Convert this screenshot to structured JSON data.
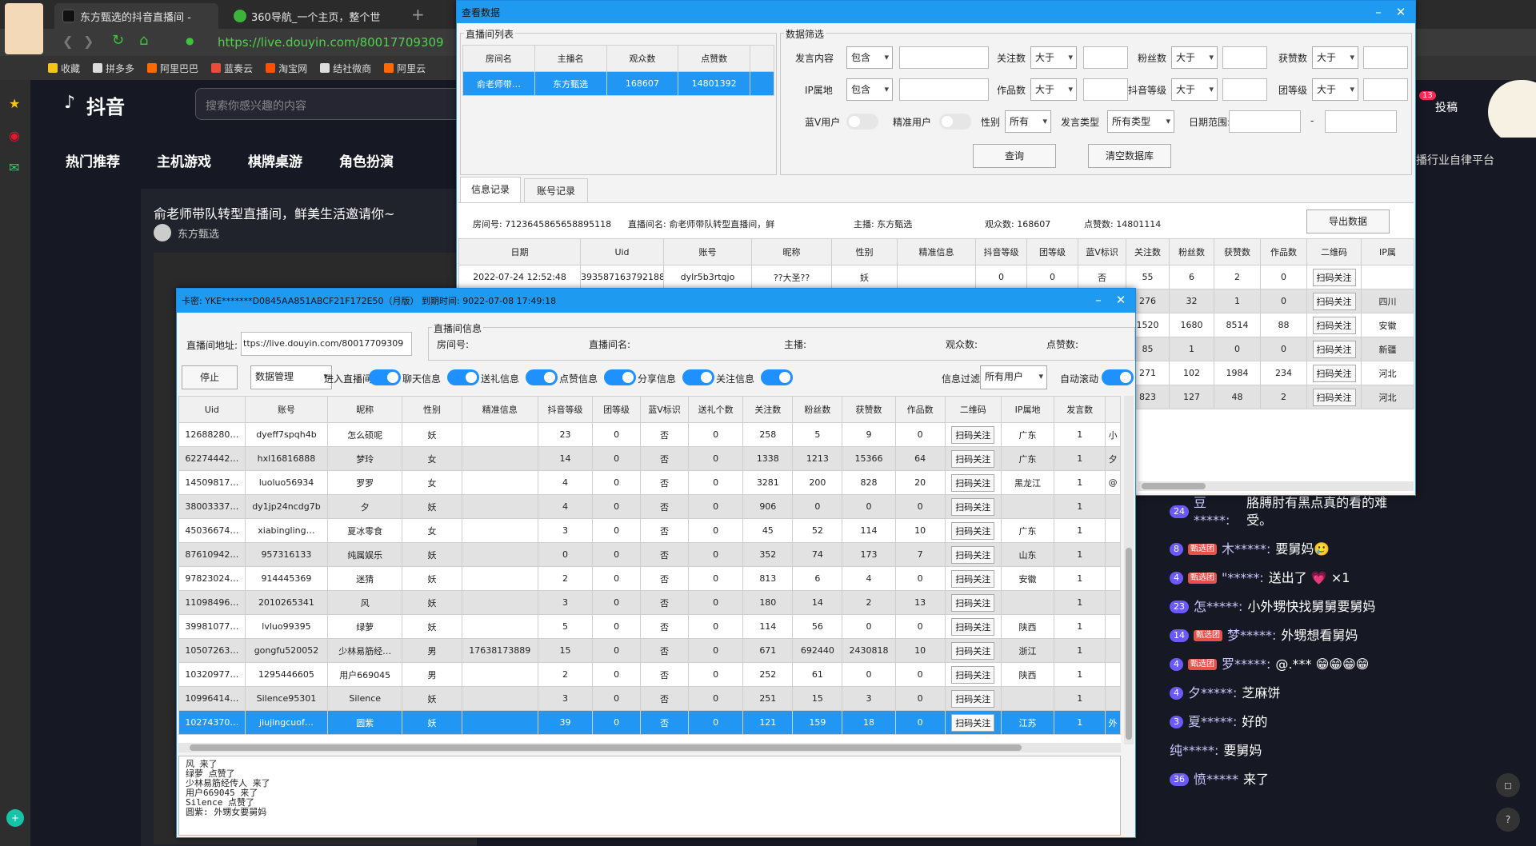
{
  "browser": {
    "tabs": [
      {
        "label": "东方甄选的抖音直播间 -"
      },
      {
        "label": "360导航_一个主页，整个世"
      }
    ],
    "url": "https://live.douyin.com/80017709309",
    "bookmarks": [
      "收藏",
      "拼多多",
      "阿里巴巴",
      "蓝奏云",
      "淘宝网",
      "结社微商",
      "阿里云"
    ]
  },
  "douyin": {
    "logo": "抖音",
    "search_placeholder": "搜索你感兴趣的内容",
    "nav": [
      "热门推荐",
      "主机游戏",
      "棋牌桌游",
      "角色扮演"
    ],
    "live_title": "俞老师带队转型直播间，鲜美生活邀请你~",
    "anchor": "东方甄选",
    "header_right": "投稿",
    "badge": "13",
    "industry_text": "播行业自律平台",
    "chat": [
      {
        "level": "24",
        "user": "豆*****:",
        "text": "胳膊肘有黑点真的看的难受。"
      },
      {
        "level": "8",
        "fan": "甄选团",
        "user": "木*****:",
        "text": "要舅妈🥲"
      },
      {
        "level": "4",
        "fan": "甄选团",
        "user": "\"*****:",
        "text": "送出了 💗 ×1"
      },
      {
        "level": "23",
        "user": "怎*****:",
        "text": "小外甥快找舅舅要舅妈"
      },
      {
        "level": "14",
        "fan": "甄选团",
        "user": "梦*****:",
        "text": "外甥想看舅妈"
      },
      {
        "level": "4",
        "fan": "甄选团",
        "user": "罗*****:",
        "text": "@.*** 😁😁😁😁"
      },
      {
        "level": "4",
        "user": "夕*****:",
        "text": "芝麻饼"
      },
      {
        "level": "3",
        "user": "夏*****:",
        "text": "好的"
      },
      {
        "level": "",
        "user": "纯*****:",
        "text": "要舅妈"
      },
      {
        "level": "36",
        "user": "愤*****",
        "text": "来了"
      }
    ]
  },
  "viewer": {
    "title": "查看数据",
    "live_list_group": "直播间列表",
    "live_list_headers": [
      "房间名",
      "主播名",
      "观众数",
      "点赞数"
    ],
    "live_list_row": [
      "俞老师带…",
      "东方甄选",
      "168607",
      "14801392"
    ],
    "filter_group": "数据筛选",
    "filters": {
      "speech_content": "发言内容",
      "contains1": "包含",
      "follow": "关注数",
      "gt1": "大于",
      "fans": "粉丝数",
      "gt2": "大于",
      "likes": "获赞数",
      "gt3": "大于",
      "ip": "IP属地",
      "contains2": "包含",
      "works": "作品数",
      "gt4": "大于",
      "dylevel": "抖音等级",
      "gt5": "大于",
      "grouplevel": "团等级",
      "gt6": "大于",
      "bluev": "蓝V用户",
      "precise": "精准用户",
      "gender": "性别",
      "all": "所有",
      "speech_type": "发言类型",
      "all_types": "所有类型",
      "date_range": "日期范围:",
      "dash": "-"
    },
    "query_btn": "查询",
    "clear_btn": "清空数据库",
    "tabs": [
      "信息记录",
      "账号记录"
    ],
    "info": {
      "room_id": "房间号: 7123645865658895118",
      "room_name": "直播间名: 俞老师带队转型直播间，鲜",
      "anchor": "主播: 东方甄选",
      "viewers": "观众数: 168607",
      "likes": "点赞数: 14801114"
    },
    "export_btn": "导出数据",
    "record_headers": [
      "日期",
      "Uid",
      "账号",
      "昵称",
      "性别",
      "精准信息",
      "抖音等级",
      "团等级",
      "蓝V标识",
      "关注数",
      "粉丝数",
      "获赞数",
      "作品数",
      "二维码",
      "IP属"
    ],
    "record_rows": [
      [
        "2022-07-24 12:52:48",
        "3935871637921880",
        "dylr5b3rtqjo",
        "??大圣??",
        "妖",
        "",
        "0",
        "0",
        "否",
        "55",
        "6",
        "2",
        "0",
        "扫码关注",
        ""
      ],
      [
        "",
        "",
        "",
        "",
        "",
        "",
        "",
        "",
        "",
        "276",
        "32",
        "1",
        "0",
        "扫码关注",
        "四川"
      ],
      [
        "",
        "",
        "",
        "",
        "",
        "",
        "",
        "",
        "",
        "1520",
        "1680",
        "8514",
        "88",
        "扫码关注",
        "安徽"
      ],
      [
        "",
        "",
        "",
        "",
        "",
        "",
        "",
        "",
        "",
        "85",
        "1",
        "0",
        "0",
        "扫码关注",
        "新疆"
      ],
      [
        "",
        "",
        "",
        "",
        "",
        "",
        "",
        "",
        "",
        "271",
        "102",
        "1984",
        "234",
        "扫码关注",
        "河北"
      ],
      [
        "",
        "",
        "",
        "",
        "",
        "",
        "",
        "",
        "",
        "823",
        "127",
        "48",
        "2",
        "扫码关注",
        "河北"
      ]
    ]
  },
  "main": {
    "title": "卡密: YKE*******D0845AA851ABCF21F172E50（月版） 到期时间: 9022-07-08 17:49:18",
    "addr_label": "直播间地址:",
    "addr_value": "ttps://live.douyin.com/80017709309",
    "info_group": "直播间信息",
    "info_labels": [
      "房间号:",
      "直播间名:",
      "主播:",
      "观众数:",
      "点赞数:"
    ],
    "stop_btn": "停止",
    "data_mgmt": "数据管理",
    "toggles": [
      "进入直播间",
      "聊天信息",
      "送礼信息",
      "点赞信息",
      "分享信息",
      "关注信息"
    ],
    "filter_label": "信息过滤",
    "filter_value": "所有用户",
    "autoscroll": "自动滚动",
    "headers": [
      "Uid",
      "账号",
      "昵称",
      "性别",
      "精准信息",
      "抖音等级",
      "团等级",
      "蓝V标识",
      "送礼个数",
      "关注数",
      "粉丝数",
      "获赞数",
      "作品数",
      "二维码",
      "IP属地",
      "发言数",
      ""
    ],
    "rows": [
      [
        "12688280…",
        "dyeff7spqh4b",
        "怎么硕呢",
        "妖",
        "",
        "23",
        "0",
        "否",
        "0",
        "258",
        "5",
        "9",
        "0",
        "扫码关注",
        "广东",
        "1",
        "小"
      ],
      [
        "62274442…",
        "hxl16816888",
        "梦玲",
        "女",
        "",
        "14",
        "0",
        "否",
        "0",
        "1338",
        "1213",
        "15366",
        "64",
        "扫码关注",
        "广东",
        "1",
        "夕"
      ],
      [
        "14509817…",
        "luoluo56934",
        "罗罗",
        "女",
        "",
        "4",
        "0",
        "否",
        "0",
        "3281",
        "200",
        "828",
        "20",
        "扫码关注",
        "黑龙江",
        "1",
        "@"
      ],
      [
        "38003337…",
        "dy1jp24ncdg7b",
        "夕",
        "妖",
        "",
        "4",
        "0",
        "否",
        "0",
        "906",
        "0",
        "0",
        "0",
        "扫码关注",
        "",
        "1",
        ""
      ],
      [
        "45036674…",
        "xiabingling…",
        "夏冰零食",
        "女",
        "",
        "3",
        "0",
        "否",
        "0",
        "45",
        "52",
        "114",
        "10",
        "扫码关注",
        "广东",
        "1",
        ""
      ],
      [
        "87610942…",
        "957316133",
        "纯属娱乐",
        "妖",
        "",
        "0",
        "0",
        "否",
        "0",
        "352",
        "74",
        "173",
        "7",
        "扫码关注",
        "山东",
        "1",
        ""
      ],
      [
        "97823024…",
        "914445369",
        "迷猜",
        "妖",
        "",
        "2",
        "0",
        "否",
        "0",
        "813",
        "6",
        "4",
        "0",
        "扫码关注",
        "安徽",
        "1",
        ""
      ],
      [
        "11098496…",
        "2010265341",
        "风",
        "妖",
        "",
        "3",
        "0",
        "否",
        "0",
        "180",
        "14",
        "2",
        "13",
        "扫码关注",
        "",
        "1",
        ""
      ],
      [
        "39981077…",
        "lvluo99395",
        "绿萝",
        "妖",
        "",
        "5",
        "0",
        "否",
        "0",
        "114",
        "56",
        "0",
        "0",
        "扫码关注",
        "陕西",
        "1",
        ""
      ],
      [
        "10507263…",
        "gongfu520052",
        "少林易筋经…",
        "男",
        "17638173889",
        "15",
        "0",
        "否",
        "0",
        "671",
        "692440",
        "2430818",
        "10",
        "扫码关注",
        "浙江",
        "1",
        ""
      ],
      [
        "10320977…",
        "1295446605",
        "用户669045",
        "男",
        "",
        "2",
        "0",
        "否",
        "0",
        "252",
        "61",
        "0",
        "0",
        "扫码关注",
        "陕西",
        "1",
        ""
      ],
      [
        "10996414…",
        "Silence95301",
        "Silence",
        "妖",
        "",
        "3",
        "0",
        "否",
        "0",
        "251",
        "15",
        "3",
        "0",
        "扫码关注",
        "",
        "1",
        ""
      ],
      [
        "10274370…",
        "jiujingcuof…",
        "圆紫",
        "妖",
        "",
        "39",
        "0",
        "否",
        "0",
        "121",
        "159",
        "18",
        "0",
        "扫码关注",
        "江苏",
        "1",
        "外"
      ]
    ],
    "log": [
      "风 来了",
      "绿萝 点赞了",
      "少林易筋经传人 来了",
      "用户669045 来了",
      "Silence 点赞了",
      "圆紫: 外甥女要舅妈"
    ]
  }
}
